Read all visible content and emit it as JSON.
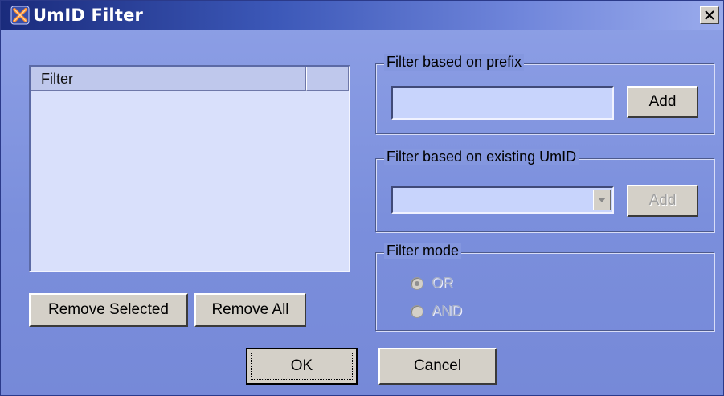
{
  "window": {
    "title": "UmID Filter",
    "close_glyph": "✕",
    "icon": "umid-app-icon"
  },
  "list": {
    "columns": [
      "Filter",
      ""
    ],
    "rows": []
  },
  "list_buttons": {
    "remove_selected": "Remove Selected",
    "remove_all": "Remove All"
  },
  "prefix_group": {
    "label": "Filter based on prefix",
    "input_value": "",
    "add_label": "Add"
  },
  "existing_group": {
    "label": "Filter based on existing UmID",
    "selected_value": "",
    "add_label": "Add",
    "add_enabled": false
  },
  "mode_group": {
    "label": "Filter mode",
    "options": [
      {
        "label": "OR",
        "selected": true,
        "enabled": false
      },
      {
        "label": "AND",
        "selected": false,
        "enabled": false
      }
    ]
  },
  "dialog_buttons": {
    "ok": "OK",
    "cancel": "Cancel"
  },
  "colors": {
    "titlebar_start": "#1a2b7c",
    "titlebar_end": "#9aabec",
    "dialog_bg": "#7f93dc",
    "list_bg": "#d9e0fb",
    "field_bg": "#c8d4fc",
    "button_face": "#d4d0c8"
  }
}
